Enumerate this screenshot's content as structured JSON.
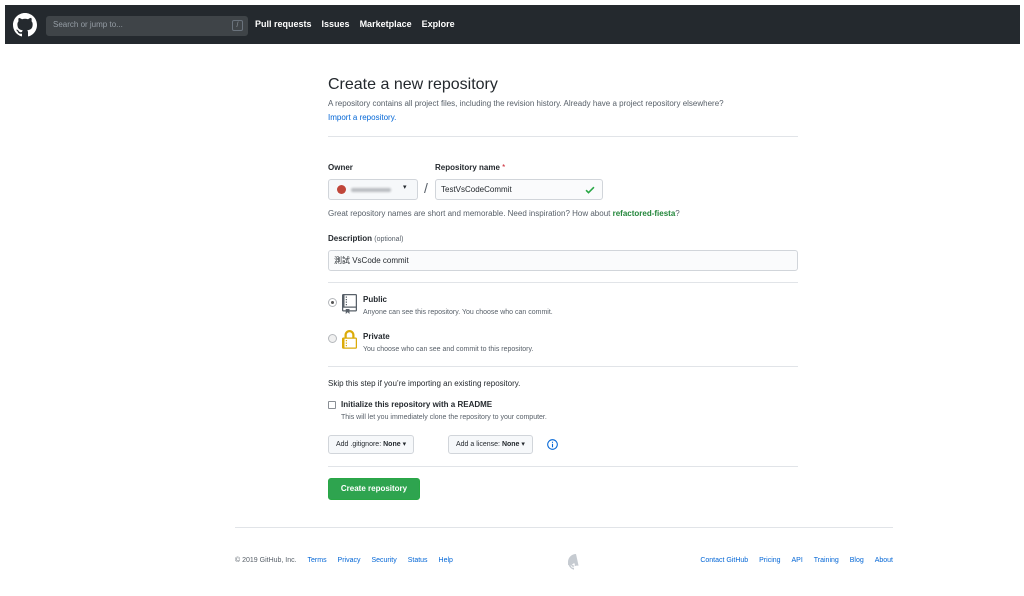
{
  "header": {
    "search_placeholder": "Search or jump to...",
    "search_shortcut": "/",
    "nav": [
      "Pull requests",
      "Issues",
      "Marketplace",
      "Explore"
    ]
  },
  "form": {
    "title": "Create a new repository",
    "lead": "A repository contains all project files, including the revision history. Already have a project repository elsewhere?",
    "import_link": "Import a repository.",
    "owner_label": "Owner",
    "repo_label": "Repository name",
    "required_mark": "*",
    "separator": "/",
    "repo_name_value": "TestVsCodeCommit",
    "hint_text": "Great repository names are short and memorable. Need inspiration? How about ",
    "hint_suggestion": "refactored-fiesta",
    "hint_end": "?",
    "description_label": "Description",
    "description_optional": "(optional)",
    "description_value": "測試 VsCode commit",
    "visibility": [
      {
        "title": "Public",
        "desc": "Anyone can see this repository. You choose who can commit.",
        "selected": true
      },
      {
        "title": "Private",
        "desc": "You choose who can see and commit to this repository.",
        "selected": false
      }
    ],
    "skip_note": "Skip this step if you’re importing an existing repository.",
    "readme_title": "Initialize this repository with a README",
    "readme_desc": "This will let you immediately clone the repository to your computer.",
    "gitignore_label": "Add .gitignore:",
    "gitignore_value": "None",
    "license_label": "Add a license:",
    "license_value": "None",
    "caret": "▾",
    "create_button": "Create repository"
  },
  "footer": {
    "copyright": "© 2019 GitHub, Inc.",
    "left_links": [
      "Terms",
      "Privacy",
      "Security",
      "Status",
      "Help"
    ],
    "right_links": [
      "Contact GitHub",
      "Pricing",
      "API",
      "Training",
      "Blog",
      "About"
    ]
  },
  "colors": {
    "header_bg": "#24292e",
    "link": "#0366d6",
    "create_button": "#2ea44f",
    "suggestion": "#22863a",
    "required": "#cb2431"
  }
}
